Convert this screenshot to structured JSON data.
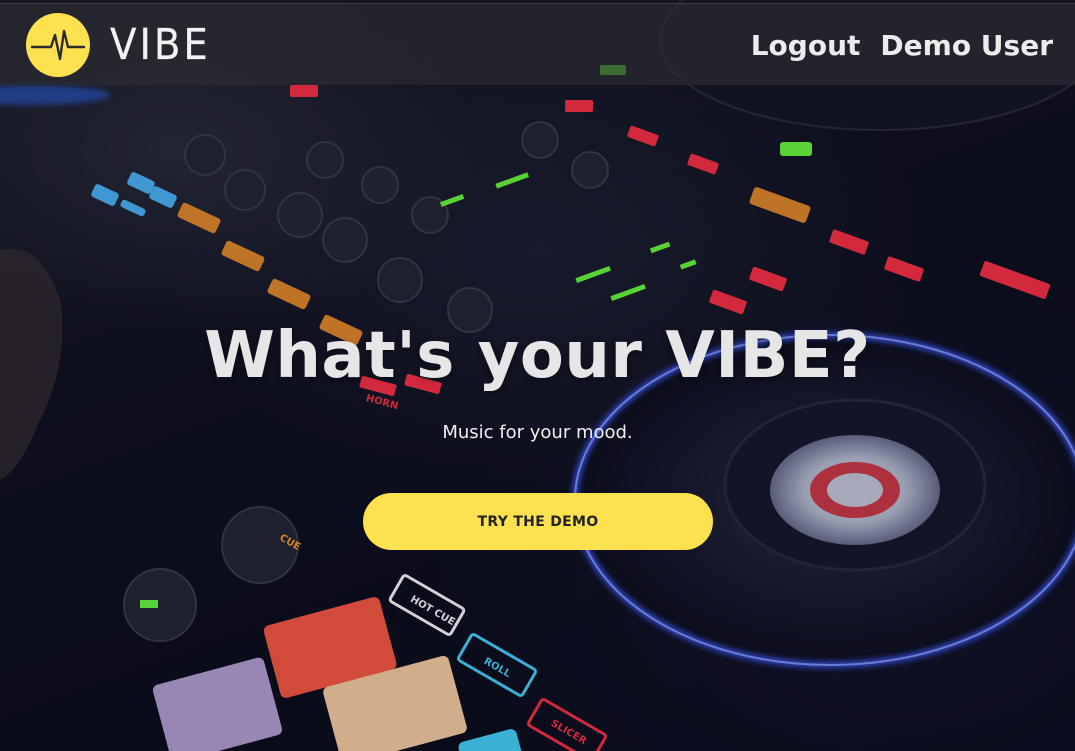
{
  "header": {
    "brand": "VIBE",
    "nav": {
      "logout_label": "Logout",
      "user_label": "Demo User"
    }
  },
  "hero": {
    "title": "What's your VIBE?",
    "subtitle": "Music for your mood.",
    "cta_label": "TRY THE DEMO"
  },
  "background": {
    "controller_labels": [
      "CUE",
      "HOT CUE",
      "ROLL",
      "SLICER",
      "HORN"
    ]
  },
  "colors": {
    "accent": "#fde14f",
    "header_bg": "#2d2d32",
    "text_light": "#ececec",
    "button_text": "#222222"
  },
  "icons": {
    "logo": "waveform-pulse-icon"
  }
}
